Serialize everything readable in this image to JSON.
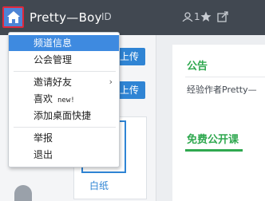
{
  "header": {
    "username": "Pretty—Boy",
    "id_label": "ID",
    "id_value": "",
    "follower_count": "1",
    "icons": [
      "home-icon",
      "user-icon",
      "star-icon",
      "share-icon"
    ]
  },
  "left": {
    "upload_buttons": [
      "上传",
      "上传"
    ],
    "card_label": "白纸"
  },
  "notice": {
    "title": "公告",
    "body": "经验作者Pretty—"
  },
  "course": {
    "title": "免费公开课"
  },
  "menu": {
    "items": [
      {
        "label": "频道信息",
        "active": true
      },
      {
        "label": "公会管理"
      },
      {
        "label": "邀请好友",
        "has_submenu": true
      },
      {
        "label": "喜欢",
        "badge": "new!"
      },
      {
        "label": "添加桌面快捷"
      },
      {
        "label": "举报"
      },
      {
        "label": "退出"
      }
    ],
    "submenu_arrow": "›"
  },
  "colors": {
    "header_bg": "#414851",
    "accent_blue": "#2f84d4",
    "menu_active": "#3e8ae0",
    "accent_green": "#2fa84f",
    "highlight_border": "#e0283c"
  }
}
